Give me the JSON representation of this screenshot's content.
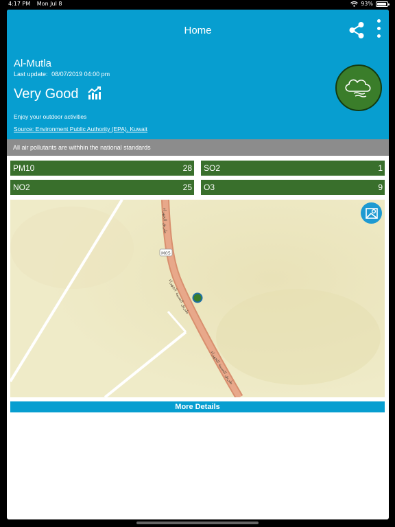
{
  "status_bar": {
    "time": "4:17 PM",
    "date": "Mon Jul 8",
    "battery": "93%"
  },
  "header": {
    "title": "Home",
    "station": "Al-Mutla",
    "last_update_label": "Last update:",
    "last_update_value": "08/07/2019 04:00 pm",
    "quality": "Very Good",
    "advice": "Enjoy your outdoor activities",
    "source": "Source: Environment Public Authority (EPA), Kuwait"
  },
  "banner": "All air pollutants are withhin the national standards",
  "pollutants": [
    {
      "name": "PM10",
      "value": "28"
    },
    {
      "name": "SO2",
      "value": "1"
    },
    {
      "name": "NO2",
      "value": "25"
    },
    {
      "name": "O3",
      "value": "9"
    }
  ],
  "map": {
    "road_code": "M05"
  },
  "more_details_label": "More Details",
  "colors": {
    "header_blue": "#079ed0",
    "pollutant_green": "#396f2c",
    "aqi_green": "#3a7d2a",
    "banner_gray": "#8c8c8c",
    "road_orange": "#e3a184"
  },
  "icons": {
    "share": "share-icon",
    "more": "more-vertical-icon",
    "trend": "trend-chart-icon",
    "aqi": "cloud-wind-icon",
    "map_layer": "map-layer-icon",
    "station_marker": "station-marker-icon"
  }
}
